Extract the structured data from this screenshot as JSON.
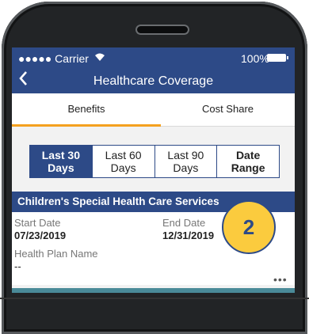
{
  "status_bar": {
    "carrier": "●●●●● Carrier",
    "battery_pct": "100%"
  },
  "nav": {
    "back_icon": "chevron-left",
    "title": "Healthcare Coverage"
  },
  "segments": {
    "items": [
      "Benefits",
      "Cost Share"
    ],
    "selected": 0
  },
  "ranges": {
    "items": [
      {
        "line1": "Last 30",
        "line2": "Days"
      },
      {
        "line1": "Last 60",
        "line2": "Days"
      },
      {
        "line1": "Last 90",
        "line2": "Days"
      },
      {
        "line1": "Date",
        "line2": "Range"
      }
    ],
    "selected": 0
  },
  "card": {
    "title": "Children's Special Health Care Services",
    "start_label": "Start Date",
    "start_value": "07/23/2019",
    "end_label": "End Date",
    "end_value": "12/31/2019",
    "plan_label": "Health Plan Name",
    "plan_value": "--",
    "more_icon": "•••"
  },
  "badge": {
    "number": "2"
  },
  "colors": {
    "primary": "#2d4a87",
    "accent": "#f4a11f",
    "badge": "#fbcb3e",
    "next_card": "#4a8a98"
  }
}
